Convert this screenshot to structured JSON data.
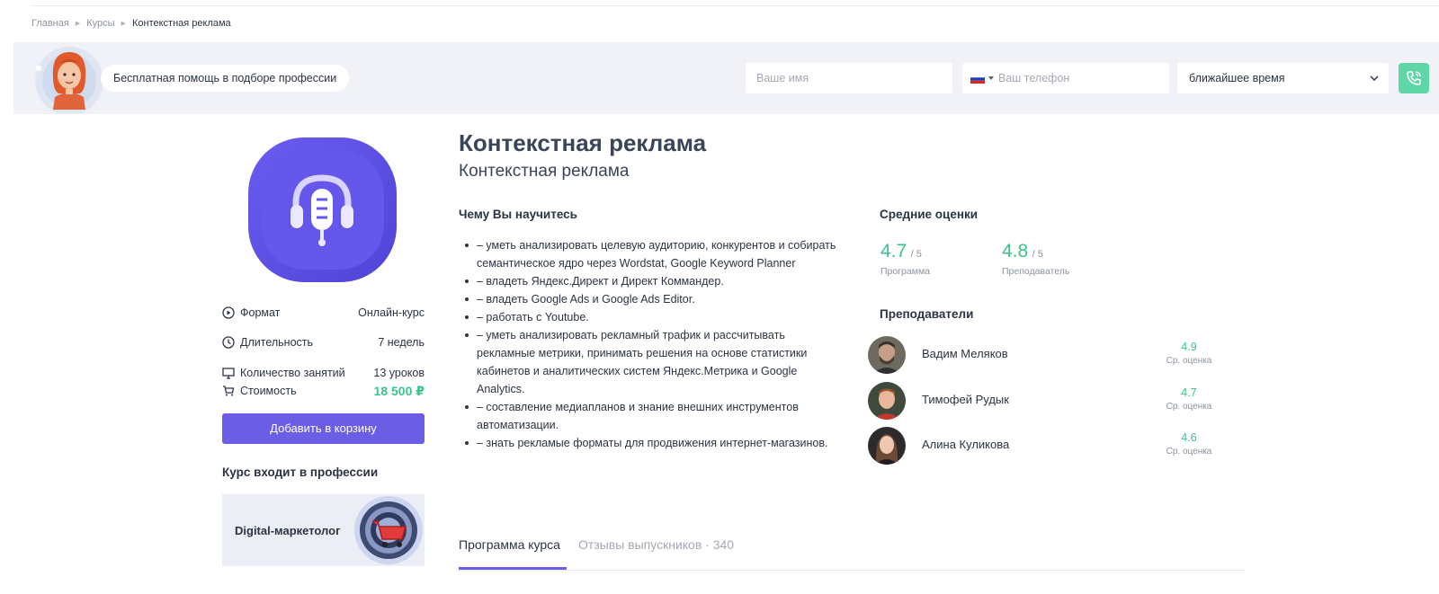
{
  "breadcrumb": {
    "items": [
      "Главная",
      "Курсы"
    ],
    "current": "Контекстная реклама"
  },
  "helpbar": {
    "text": "Бесплатная помощь в подборе профессии",
    "name_placeholder": "Ваше имя",
    "phone_placeholder": "Ваш телефон",
    "time_value": "ближайшее время",
    "call_icon": "phone-icon"
  },
  "course": {
    "title": "Контекстная реклама",
    "subtitle": "Контекстная реклама",
    "logo_icon": "headset-microphone-icon",
    "props": [
      {
        "label": "Формат",
        "value": "Онлайн-курс",
        "icon": "play-circle-icon"
      },
      {
        "label": "Длительность",
        "value": "7 недель",
        "icon": "clock-icon"
      },
      {
        "label": "Количество занятий",
        "value": "13 уроков",
        "icon": "monitor-icon"
      },
      {
        "label": "Стоимость",
        "value": "18 500 ₽",
        "icon": "cart-icon"
      }
    ],
    "cart_button": "Добавить в корзину",
    "professions_title": "Курс входит в профессии",
    "profession": "Digital-маркетолог"
  },
  "learn": {
    "title": "Чему Вы научитесь",
    "items": [
      "– уметь анализировать целевую аудиторию, конкурентов и собирать семантическое ядро через Wordstat, Google Keyword Planner",
      "– владеть Яндекс.Директ и Директ Коммандер.",
      "– владеть Google Ads и Google Ads Editor.",
      "– работать с Youtube.",
      "– уметь анализировать рекламный трафик и рассчитывать рекламные метрики, принимать решения на основе статистики кабинетов и аналитических систем Яндекс.Метрика и Google Analytics.",
      "– составление медиапланов и знание внешних инструментов автоматизации.",
      "– знать рекламые форматы для продвижения интернет-магазинов."
    ]
  },
  "ratings": {
    "title": "Средние оценки",
    "scale": "/ 5",
    "program": {
      "value": "4.7",
      "label": "Программа"
    },
    "teacher": {
      "value": "4.8",
      "label": "Преподаватель"
    }
  },
  "teachers": {
    "title": "Преподаватели",
    "avg_label": "Ср. оценка",
    "list": [
      {
        "name": "Вадим Меляков",
        "rating": "4.9"
      },
      {
        "name": "Тимофей Рудык",
        "rating": "4.7"
      },
      {
        "name": "Алина Куликова",
        "rating": "4.6"
      }
    ]
  },
  "tabs": {
    "program": "Программа курса",
    "reviews": "Отзывы выпускников · 340"
  },
  "colors": {
    "accent": "#6b5de6",
    "green": "#3cc28a",
    "helpbar_bg": "#f0f2f7"
  }
}
